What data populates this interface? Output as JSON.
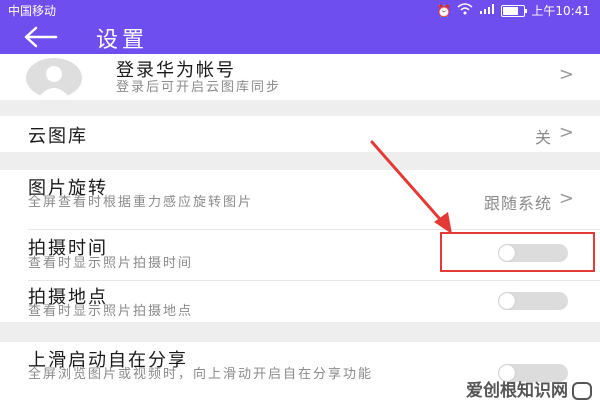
{
  "status_bar": {
    "carrier": "中国移动",
    "time": "上午10:41",
    "icons": [
      "alarm-icon",
      "wifi-icon",
      "signal-icon",
      "battery-icon"
    ],
    "battery_level": 0.85
  },
  "app_bar": {
    "title": "设置",
    "back_icon": "back-arrow-icon"
  },
  "account": {
    "title": "登录华为帐号",
    "subtitle": "登录后可开启云图库同步",
    "chevron": ">"
  },
  "cloud_gallery": {
    "title": "云图库",
    "value": "关",
    "chevron": ">"
  },
  "photo_rotation": {
    "title": "图片旋转",
    "subtitle": "全屏查看时根据重力感应旋转图片",
    "value": "跟随系统",
    "chevron": ">"
  },
  "shooting_time": {
    "title": "拍摄时间",
    "subtitle": "查看时显示照片拍摄时间",
    "enabled": false
  },
  "shooting_location": {
    "title": "拍摄地点",
    "subtitle": "查看时显示照片拍摄地点",
    "enabled": false
  },
  "swipe_share": {
    "title": "上滑启动自在分享",
    "subtitle": "全屏浏览图片或视频时，向上滑动开启自在分享功能",
    "enabled": false
  },
  "annotation": {
    "color": "#e53935"
  },
  "watermark": {
    "text": "爱创根知识网"
  },
  "colors": {
    "accent": "#6f4ef0",
    "toggle_off": "#dcdcdc",
    "section_gap": "#eeeeee"
  }
}
